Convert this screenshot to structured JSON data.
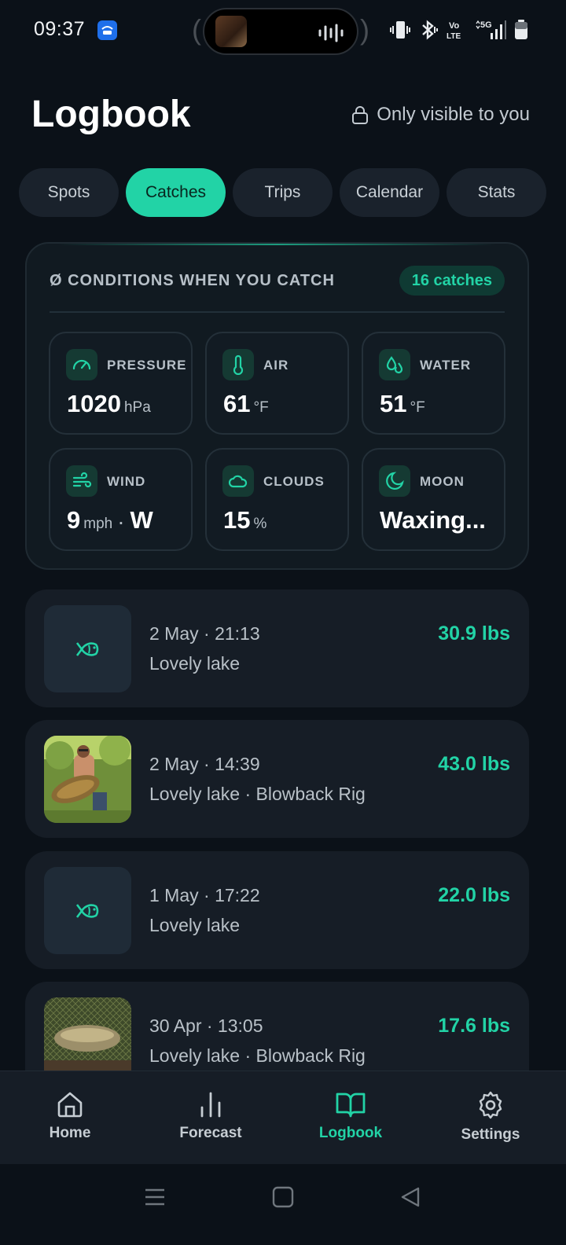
{
  "status_bar": {
    "time": "09:37",
    "icons": [
      "vibrate-icon",
      "bluetooth-icon",
      "volte-icon",
      "5g-signal-icon",
      "battery-icon"
    ],
    "volte_text": "Vo\nLTE",
    "network_text": "5G"
  },
  "header": {
    "title": "Logbook",
    "privacy_text": "Only visible to you"
  },
  "tabs": [
    {
      "label": "Spots",
      "active": false
    },
    {
      "label": "Catches",
      "active": true
    },
    {
      "label": "Trips",
      "active": false
    },
    {
      "label": "Calendar",
      "active": false
    },
    {
      "label": "Stats",
      "active": false
    }
  ],
  "conditions": {
    "title": "Ø CONDITIONS WHEN YOU CATCH",
    "badge": "16 catches",
    "tiles": [
      {
        "label": "PRESSURE",
        "value": "1020",
        "unit": "hPa",
        "icon": "gauge-icon"
      },
      {
        "label": "AIR",
        "value": "61",
        "unit": "°F",
        "icon": "thermometer-icon"
      },
      {
        "label": "WATER",
        "value": "51",
        "unit": "°F",
        "icon": "droplets-icon"
      },
      {
        "label": "WIND",
        "value": "9",
        "unit": "mph",
        "sep": "·",
        "extra": "W",
        "icon": "wind-icon"
      },
      {
        "label": "CLOUDS",
        "value": "15",
        "unit": "%",
        "icon": "cloud-icon"
      },
      {
        "label": "MOON",
        "value": "Waxing...",
        "unit": "",
        "icon": "moon-icon"
      }
    ]
  },
  "catches": [
    {
      "date": "2 May · 21:13",
      "location": "Lovely lake",
      "weight": "30.9 lbs",
      "thumb": "fish-icon"
    },
    {
      "date": "2 May · 14:39",
      "location": "Lovely lake  · Blowback Rig",
      "weight": "43.0 lbs",
      "thumb": "photo"
    },
    {
      "date": "1 May · 17:22",
      "location": "Lovely lake",
      "weight": "22.0 lbs",
      "thumb": "fish-icon"
    },
    {
      "date": "30 Apr · 13:05",
      "location": "Lovely lake  · Blowback Rig",
      "weight": "17.6 lbs",
      "thumb": "photo"
    }
  ],
  "bottom_nav": [
    {
      "label": "Home",
      "icon": "home-icon",
      "active": false
    },
    {
      "label": "Forecast",
      "icon": "bar-chart-icon",
      "active": false
    },
    {
      "label": "Logbook",
      "icon": "book-open-icon",
      "active": true
    },
    {
      "label": "Settings",
      "icon": "gear-icon",
      "active": false
    }
  ],
  "colors": {
    "accent": "#22d3a6",
    "background": "#0b1118",
    "card": "#161d26"
  }
}
